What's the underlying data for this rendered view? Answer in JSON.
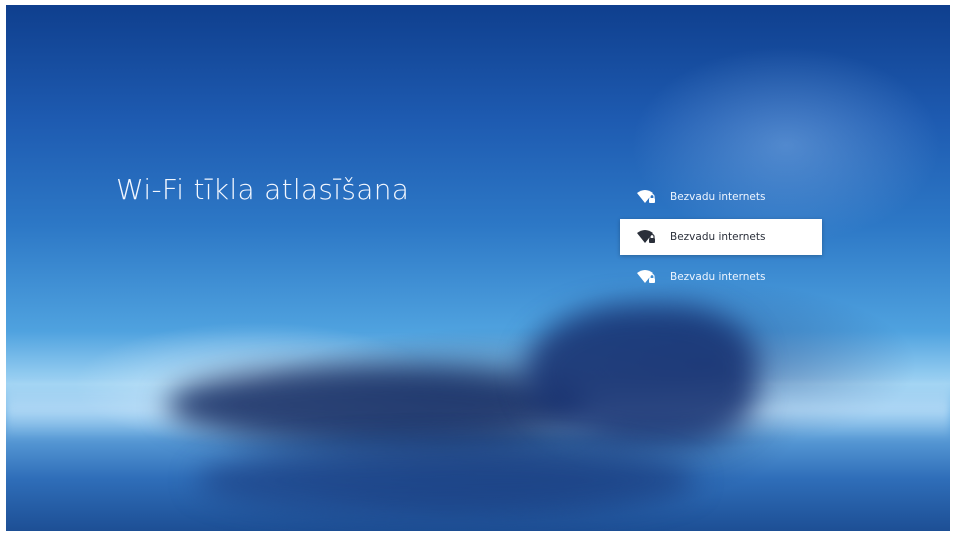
{
  "screen": {
    "title": "Wi-Fi tīkla atlasīšana"
  },
  "networks": [
    {
      "name": "Bezvadu internets",
      "icon": "wifi-lock-icon",
      "selected": false
    },
    {
      "name": "Bezvadu internets",
      "icon": "wifi-lock-icon",
      "selected": true
    },
    {
      "name": "Bezvadu internets",
      "icon": "wifi-lock-icon",
      "selected": false
    }
  ],
  "colors": {
    "background_top": "#0f3f8e",
    "background_horizon": "#9fd3f3",
    "text": "#f2f7ff",
    "selected_bg": "#ffffff",
    "selected_text": "#2a2f3a"
  }
}
